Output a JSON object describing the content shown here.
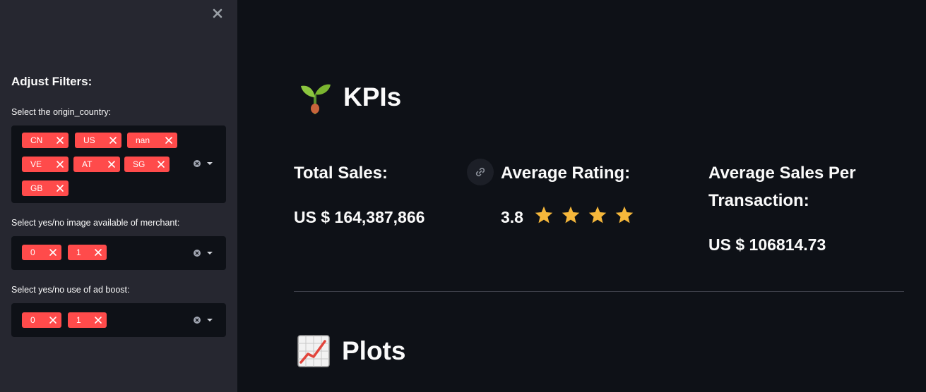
{
  "sidebar": {
    "title": "Adjust Filters:",
    "filters": [
      {
        "label": "Select the origin_country:",
        "selected": [
          "CN",
          "US",
          "nan",
          "VE",
          "AT",
          "SG",
          "GB"
        ]
      },
      {
        "label": "Select yes/no image available of merchant:",
        "selected": [
          "0",
          "1"
        ]
      },
      {
        "label": "Select yes/no use of ad boost:",
        "selected": [
          "0",
          "1"
        ]
      }
    ]
  },
  "main": {
    "kpi_heading": "KPIs",
    "kpi_heading_icon": "seedling-emoji",
    "kpis": {
      "total_sales": {
        "label": "Total Sales:",
        "value": "US $ 164,387,866"
      },
      "average_rating": {
        "label": "Average Rating:",
        "value": "3.8",
        "stars": 4
      },
      "avg_sales_per_txn": {
        "label": "Average Sales Per Transaction:",
        "value": "US $ 106814.73"
      }
    },
    "plots_heading": "Plots",
    "plots_heading_icon": "chart-increasing-emoji"
  },
  "colors": {
    "sidebar_bg": "#262730",
    "app_bg": "#0e1117",
    "tag_accent": "#ff4b4b",
    "star": "#f5b73b"
  }
}
